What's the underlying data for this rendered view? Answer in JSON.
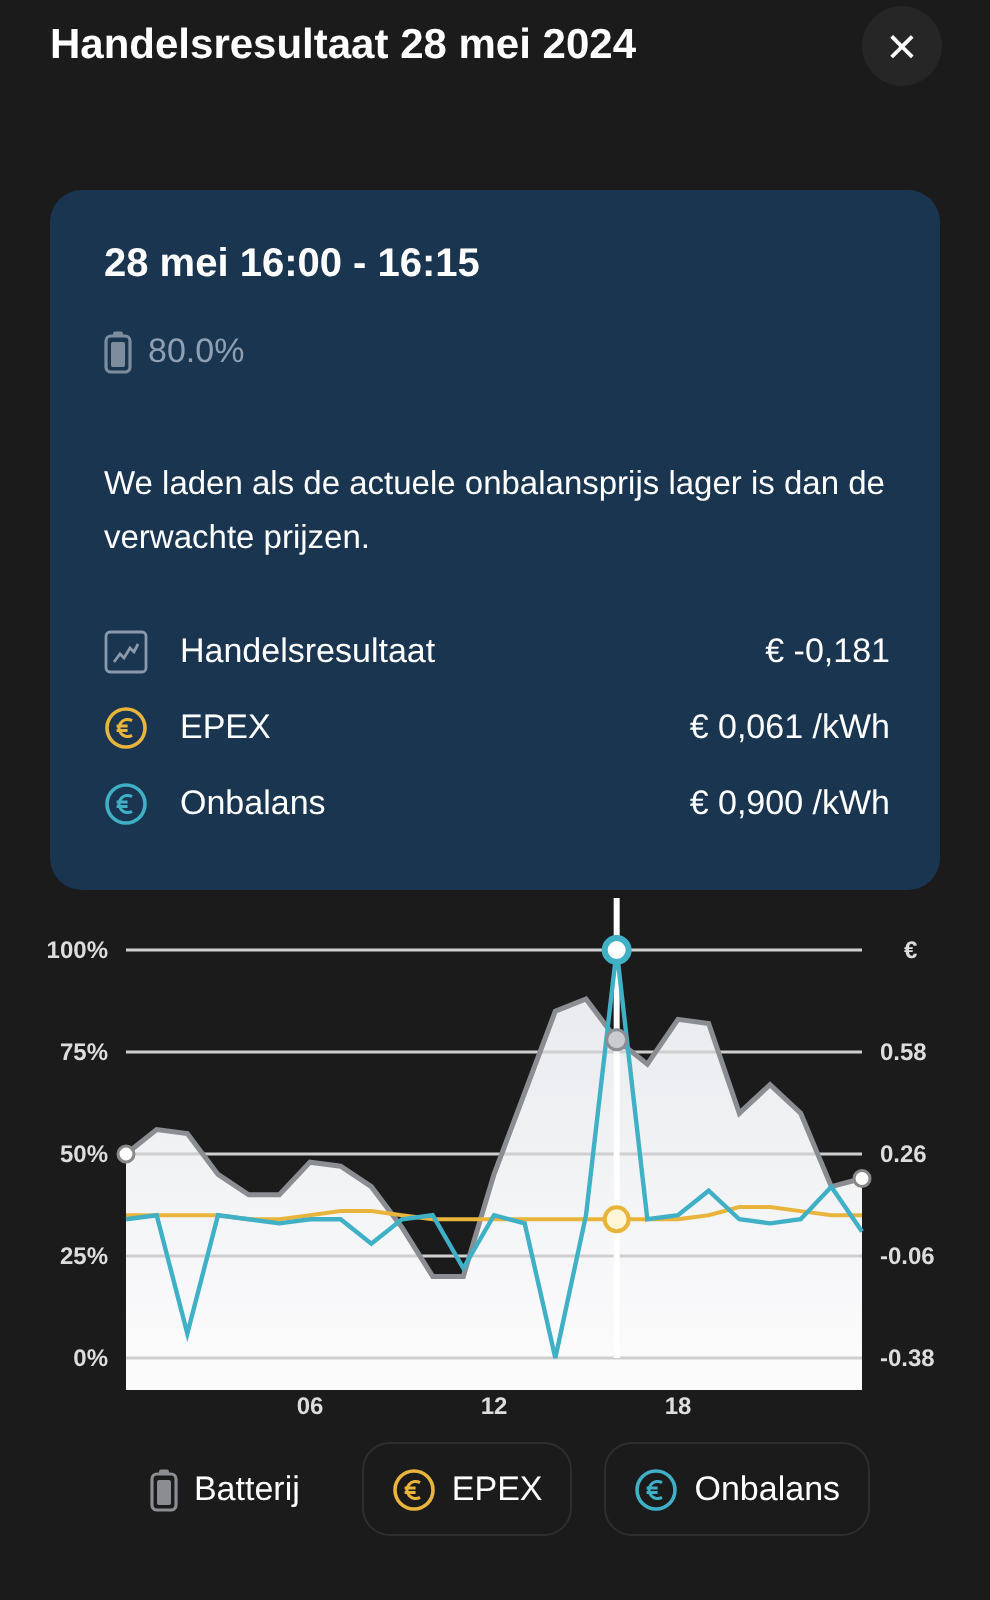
{
  "title": "Handelsresultaat 28 mei 2024",
  "close": "×",
  "card": {
    "period": "28 mei 16:00 - 16:15",
    "battery": "80.0%",
    "message": "We laden als de actuele onbalansprijs lager is dan de verwachte prijzen.",
    "rows": [
      {
        "kind": "result",
        "label": "Handelsresultaat",
        "value": "€ -0,181"
      },
      {
        "kind": "euro",
        "color": "#e9b43c",
        "label": "EPEX",
        "value": "€ 0,061 /kWh"
      },
      {
        "kind": "euro",
        "color": "#3fb0c6",
        "label": "Onbalans",
        "value": "€ 0,900 /kWh"
      }
    ]
  },
  "chart": {
    "price_axis": [
      "€",
      "0.58",
      "0.26",
      "-0.06",
      "-0.38"
    ],
    "chart_data": {
      "type": "line",
      "grid": true,
      "x": [
        0,
        1,
        2,
        3,
        4,
        5,
        6,
        7,
        8,
        9,
        10,
        11,
        12,
        13,
        14,
        15,
        16,
        17,
        18,
        19,
        20,
        21,
        22,
        23,
        24
      ],
      "xlim": [
        0,
        24
      ],
      "xticks": [
        {
          "value": 6,
          "label": "06"
        },
        {
          "value": 12,
          "label": "12"
        },
        {
          "value": 18,
          "label": "18"
        }
      ],
      "ylim": [
        0,
        100
      ],
      "yticks": [
        {
          "value": 100,
          "label": "100%"
        },
        {
          "value": 75,
          "label": "75%"
        },
        {
          "value": 50,
          "label": "50%"
        },
        {
          "value": 25,
          "label": "25%"
        },
        {
          "value": 0,
          "label": "0%"
        }
      ],
      "ref_lines": [
        {
          "axis": "x",
          "value": 16,
          "color": "#ffffff"
        }
      ],
      "series": [
        {
          "name": "Batterij",
          "type": "area",
          "color": "#8a8d92",
          "values": [
            50,
            56,
            55,
            45,
            40,
            40,
            48,
            47,
            42,
            32,
            20,
            20,
            45,
            65,
            85,
            88,
            78,
            72,
            83,
            82,
            60,
            67,
            60,
            42,
            44
          ]
        },
        {
          "name": "EPEX",
          "color": "#e9b43c",
          "values": [
            35,
            35,
            35,
            35,
            34,
            34,
            35,
            36,
            36,
            35,
            34,
            34,
            34,
            34,
            34,
            34,
            34,
            34,
            34,
            35,
            37,
            37,
            36,
            35,
            35
          ]
        },
        {
          "name": "Onbalans",
          "color": "#3fb0c6",
          "values": [
            34,
            35,
            6,
            35,
            34,
            33,
            34,
            34,
            28,
            34,
            35,
            22,
            35,
            33,
            0,
            35,
            100,
            34,
            35,
            41,
            34,
            33,
            34,
            42,
            31
          ]
        }
      ]
    }
  },
  "legend": [
    {
      "kind": "battery",
      "outlined": false
    },
    {
      "kind": "euro",
      "color": "#e9b43c",
      "outlined": true
    },
    {
      "kind": "euro",
      "color": "#3fb0c6",
      "outlined": true
    }
  ]
}
